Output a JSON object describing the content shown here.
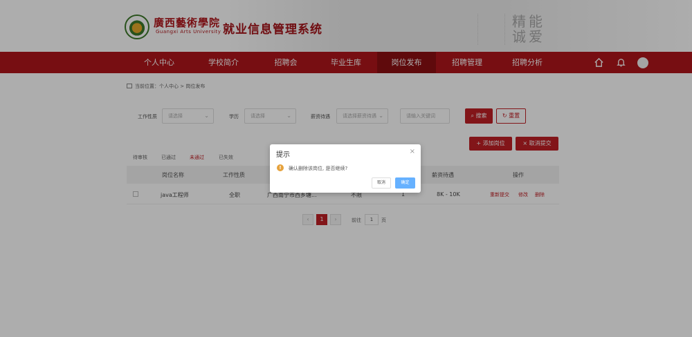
{
  "header": {
    "school_cn": "廣西藝術學院",
    "school_en": "Guangxi Arts University",
    "system_title": "就业信息管理系统",
    "calligraphy": "精能\n诚爱"
  },
  "nav": {
    "items": [
      "个人中心",
      "学校简介",
      "招聘会",
      "毕业生库",
      "岗位发布",
      "招聘管理",
      "招聘分析"
    ],
    "active_index": 4
  },
  "breadcrumb": "当前位置：个人中心 > 岗位发布",
  "filters": {
    "work_type_label": "工作性质",
    "work_type_placeholder": "请选择",
    "education_label": "学历",
    "education_placeholder": "请选择",
    "salary_label": "薪资待遇",
    "salary_placeholder": "请选择薪资待遇",
    "keyword_placeholder": "请输入关键词",
    "search_label": "搜索",
    "reset_label": "重置"
  },
  "actions": {
    "add_label": "+ 添加岗位",
    "cancel_submit_label": "× 取消提交"
  },
  "tabs": [
    "待审核",
    "已通过",
    "未通过",
    "已失效"
  ],
  "active_tab": 2,
  "table": {
    "headers": [
      "岗位名称",
      "工作性质",
      "",
      "",
      "",
      "薪资待遇",
      "操作"
    ],
    "rows": [
      {
        "name": "java工程师",
        "type": "全职",
        "desc": "广西南宁市西乡塘...",
        "education": "不限",
        "count": "1",
        "salary": "8K - 10K",
        "ops": [
          "重新提交",
          "修改",
          "删除"
        ]
      }
    ]
  },
  "pagination": {
    "prev": "‹",
    "current": "1",
    "next": "›",
    "goto_label": "前往",
    "goto_value": "1",
    "page_suffix": "页"
  },
  "dialog": {
    "title": "提示",
    "message": "确认删除该岗位, 是否继续?",
    "cancel": "取消",
    "confirm": "确定",
    "close": "×",
    "warn_glyph": "!"
  },
  "colors": {
    "brand_red": "#b0161b",
    "nav_active": "#8c0f13",
    "primary_blue": "#66b1ff",
    "warning": "#e6a23c"
  }
}
